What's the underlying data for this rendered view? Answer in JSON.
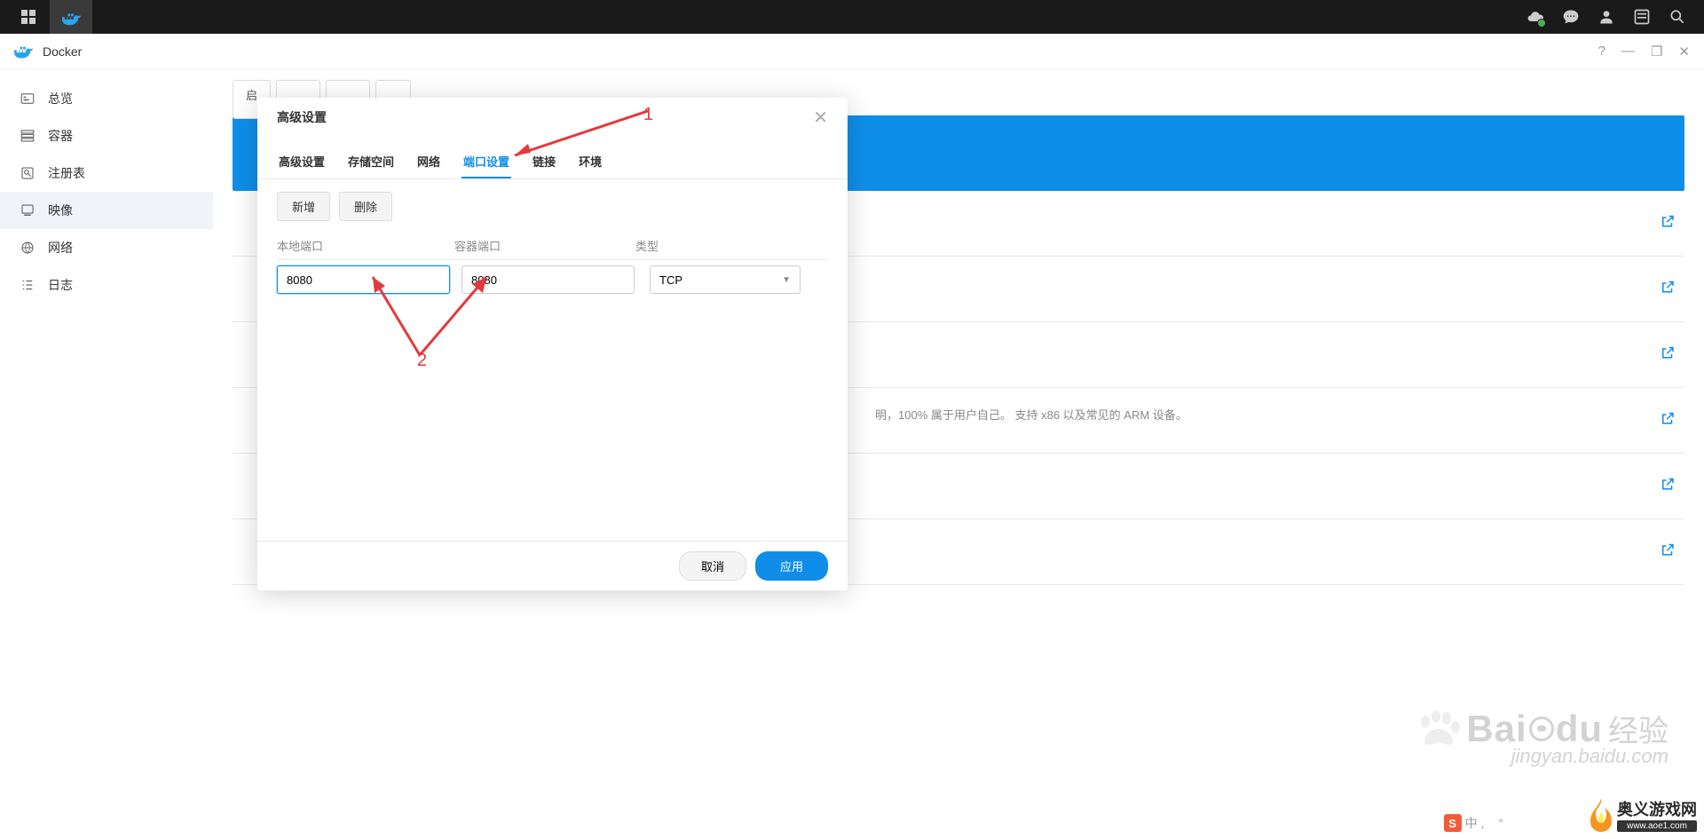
{
  "topbar": {},
  "window": {
    "title": "Docker",
    "help": "?",
    "min": "—",
    "max": "❐",
    "close": "✕"
  },
  "sidebar": {
    "items": [
      {
        "label": "总览",
        "id": "overview"
      },
      {
        "label": "容器",
        "id": "container"
      },
      {
        "label": "注册表",
        "id": "registry"
      },
      {
        "label": "映像",
        "id": "image"
      },
      {
        "label": "网络",
        "id": "network"
      },
      {
        "label": "日志",
        "id": "log"
      }
    ]
  },
  "main": {
    "desc_fragment": "明，100% 属于用户自己。 支持 x86 以及常见的 ARM 设备。",
    "stub_btn": "启"
  },
  "modal": {
    "title": "高级设置",
    "tabs": [
      {
        "label": "高级设置"
      },
      {
        "label": "存储空间"
      },
      {
        "label": "网络"
      },
      {
        "label": "端口设置",
        "active": true
      },
      {
        "label": "链接"
      },
      {
        "label": "环境"
      }
    ],
    "buttons": {
      "add": "新增",
      "delete": "删除"
    },
    "columns": {
      "local": "本地端口",
      "container": "容器端口",
      "type": "类型"
    },
    "row": {
      "local_port": "8080",
      "container_port": "8080",
      "type": "TCP"
    },
    "footer": {
      "cancel": "取消",
      "apply": "应用"
    }
  },
  "annotations": {
    "n1": "1",
    "n2": "2"
  },
  "watermark": {
    "brand": "Bai",
    "du": "du",
    "jy": "经验",
    "url": "jingyan.baidu.com"
  },
  "sitelogo": {
    "name": "奥义游戏网",
    "url": "www.aoe1.com"
  },
  "sogou": {
    "s": "S",
    "txt": "中"
  }
}
